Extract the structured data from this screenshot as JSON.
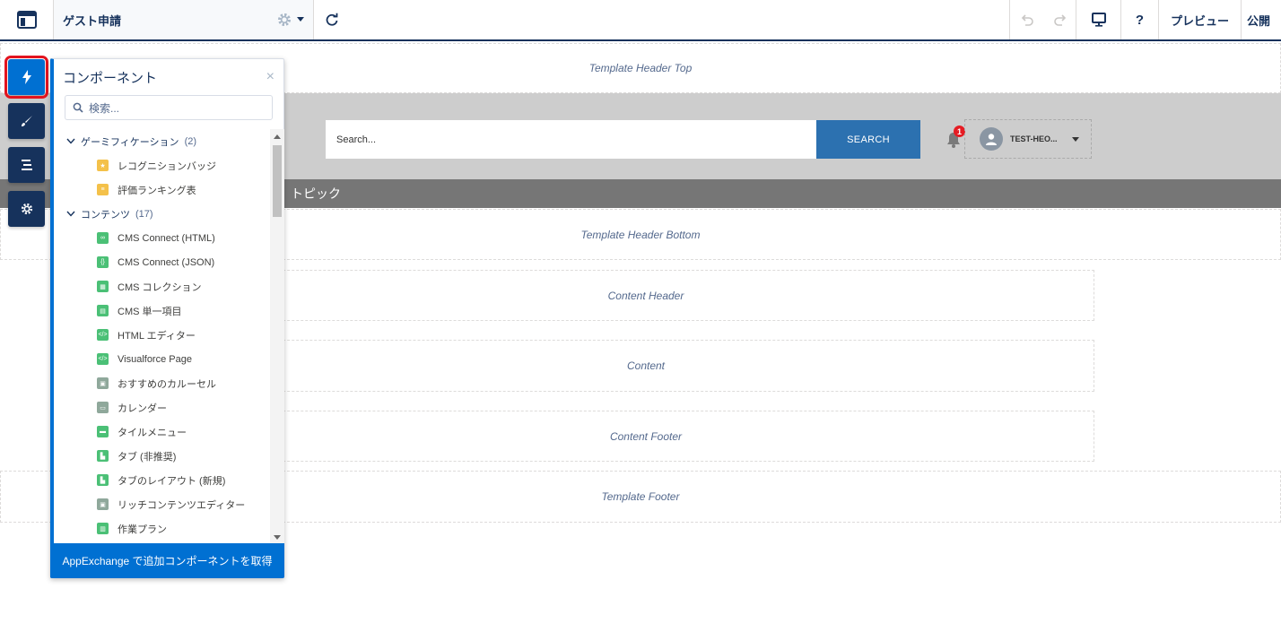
{
  "topbar": {
    "page_name": "ゲスト申請",
    "help_label": "?",
    "preview_label": "プレビュー",
    "publish_label": "公開"
  },
  "regions": {
    "header_top": "Template Header Top",
    "header_bottom": "Template Header Bottom",
    "content_header": "Content Header",
    "content": "Content",
    "content_footer": "Content Footer",
    "template_footer": "Template Footer"
  },
  "header": {
    "search_placeholder": "Search...",
    "search_button": "SEARCH",
    "notification_count": "1",
    "user_name": "TEST-HEO...",
    "topic_label": "トピック"
  },
  "panel": {
    "title": "コンポーネント",
    "close_label": "×",
    "search_placeholder": "検索...",
    "groups": [
      {
        "label": "ゲーミフィケーション",
        "count": "(2)",
        "items": [
          "レコグニションバッジ",
          "評価ランキング表"
        ]
      },
      {
        "label": "コンテンツ",
        "count": "(17)",
        "items": [
          "CMS Connect (HTML)",
          "CMS Connect (JSON)",
          "CMS コレクション",
          "CMS 単一項目",
          "HTML エディター",
          "Visualforce Page",
          "おすすめのカルーセル",
          "カレンダー",
          "タイルメニュー",
          "タブ (非推奨)",
          "タブのレイアウト (新規)",
          "リッチコンテンツエディター",
          "作業プラン"
        ]
      }
    ],
    "footer_label": "AppExchange で追加コンポーネントを取得"
  },
  "colors": {
    "brand_blue": "#0070d2",
    "navy": "#16325c",
    "search_button": "#2c71b0",
    "topic_bar": "#767676",
    "badge_red": "#e51c23",
    "active_outline": "#e3141f"
  }
}
